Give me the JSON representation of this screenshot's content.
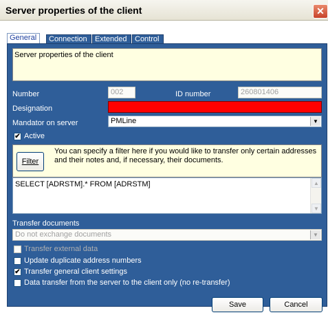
{
  "window": {
    "title": "Server properties of the client",
    "close_glyph": "✕"
  },
  "tabs": [
    {
      "label": "General",
      "active": true
    },
    {
      "label": "Connection",
      "active": false
    },
    {
      "label": "Extended",
      "active": false
    },
    {
      "label": "Control",
      "active": false
    }
  ],
  "description": "Server properties of the client",
  "number": {
    "label": "Number",
    "value": "002"
  },
  "id_number": {
    "label": "ID number",
    "value": "260801406"
  },
  "designation": {
    "label": "Designation",
    "value": ""
  },
  "mandator": {
    "label": "Mandator on server",
    "value": "PMLine"
  },
  "active": {
    "label": "Active",
    "checked": true
  },
  "filter": {
    "button_label": "Filter",
    "hint": "You can specify a filter here if you would like to transfer only certain addresses and their notes and, if necessary, their documents.",
    "query": "SELECT [ADRSTM].* FROM [ADRSTM]"
  },
  "transfer_documents": {
    "label": "Transfer documents",
    "value": "Do not exchange documents"
  },
  "options": [
    {
      "label": "Transfer external data",
      "checked": false,
      "disabled": true
    },
    {
      "label": "Update duplicate address numbers",
      "checked": false,
      "disabled": false
    },
    {
      "label": "Transfer general client settings",
      "checked": true,
      "disabled": false
    },
    {
      "label": "Data transfer from the server to the client only (no re-transfer)",
      "checked": false,
      "disabled": false
    }
  ],
  "buttons": {
    "save": "Save",
    "cancel": "Cancel"
  },
  "colors": {
    "panel": "#2f5e99",
    "info": "#ffffe1",
    "designation_error": "#ff0000"
  }
}
